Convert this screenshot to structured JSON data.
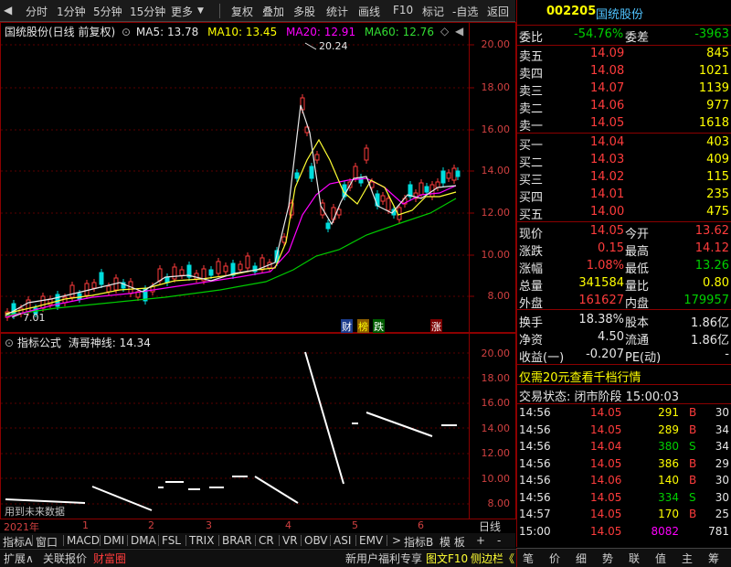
{
  "toolbar": {
    "items": [
      "分时",
      "1分钟",
      "5分钟",
      "15分钟",
      "更多",
      "复权",
      "叠加",
      "多股",
      "统计",
      "画线",
      "F10",
      "标记",
      "-自选",
      "返回"
    ]
  },
  "main_chart": {
    "title": "国统股份(日线 前复权)",
    "ma5": "MA5: 13.78",
    "ma10": "MA10: 13.45",
    "ma20": "MA20: 12.91",
    "ma60": "MA60: 12.76",
    "high_label": "20.24",
    "low_label": "7.01",
    "y_labels": [
      "20.00",
      "18.00",
      "16.00",
      "14.00",
      "12.00",
      "10.00",
      "8.00"
    ],
    "markers": [
      "财",
      "榜",
      "跌",
      "涨"
    ],
    "collapse_icon": "◇",
    "toggle_icon": "◀"
  },
  "indicator": {
    "title": "指标公式",
    "name": "涛哥神线: 14.34",
    "note": "用到未来数据",
    "y_labels": [
      "20.00",
      "18.00",
      "16.00",
      "14.00",
      "12.00",
      "10.00",
      "8.00"
    ]
  },
  "time_axis": {
    "year": "2021年",
    "months": [
      "1",
      "2",
      "3",
      "4",
      "5",
      "6"
    ],
    "period": "日线"
  },
  "indicator_tabs": {
    "left": [
      "指标A",
      "窗口",
      "MACD",
      "DMI",
      "DMA",
      "FSL",
      "TRIX",
      "BRAR",
      "CR",
      "VR",
      "OBV",
      "ASI",
      "EMV"
    ],
    "more": ">",
    "right": [
      "指标B",
      "模 板",
      "+",
      "-"
    ]
  },
  "bottom_tabs": {
    "left": [
      "扩展∧",
      "关联报价",
      "财富圈"
    ],
    "right": [
      "新用户福利专享",
      "图文F10",
      "侧边栏《"
    ],
    "panel_tabs": [
      "笔",
      "价",
      "细",
      "势",
      "联",
      "值",
      "主",
      "筹"
    ]
  },
  "quote": {
    "code": "002205",
    "name": "国统股份",
    "weibi_label": "委比",
    "weibi": "-54.76%",
    "weicha_label": "委差",
    "weicha": "-3963",
    "sells": [
      {
        "label": "卖五",
        "price": "14.09",
        "vol": "845"
      },
      {
        "label": "卖四",
        "price": "14.08",
        "vol": "1021"
      },
      {
        "label": "卖三",
        "price": "14.07",
        "vol": "1139"
      },
      {
        "label": "卖二",
        "price": "14.06",
        "vol": "977"
      },
      {
        "label": "卖一",
        "price": "14.05",
        "vol": "1618"
      }
    ],
    "buys": [
      {
        "label": "买一",
        "price": "14.04",
        "vol": "403"
      },
      {
        "label": "买二",
        "price": "14.03",
        "vol": "409"
      },
      {
        "label": "买三",
        "price": "14.02",
        "vol": "115"
      },
      {
        "label": "买四",
        "price": "14.01",
        "vol": "235"
      },
      {
        "label": "买五",
        "price": "14.00",
        "vol": "475"
      }
    ],
    "stats": [
      {
        "l1": "现价",
        "v1": "14.05",
        "l2": "今开",
        "v2": "13.62"
      },
      {
        "l1": "涨跌",
        "v1": "0.15",
        "l2": "最高",
        "v2": "14.12"
      },
      {
        "l1": "涨幅",
        "v1": "1.08%",
        "l2": "最低",
        "v2": "13.26"
      },
      {
        "l1": "总量",
        "v1": "341584",
        "l2": "量比",
        "v2": "0.80"
      },
      {
        "l1": "外盘",
        "v1": "161627",
        "l2": "内盘",
        "v2": "179957"
      }
    ],
    "stats2": [
      {
        "l1": "换手",
        "v1": "18.38%",
        "l2": "股本",
        "v2": "1.86亿"
      },
      {
        "l1": "净资",
        "v1": "4.50",
        "l2": "流通",
        "v2": "1.86亿"
      },
      {
        "l1": "收益(一)",
        "v1": "-0.207",
        "l2": "PE(动)",
        "v2": "-"
      }
    ],
    "promo": "仅需20元查看千档行情",
    "status": "交易状态: 闭市阶段 15:00:03",
    "ticks": [
      {
        "t": "14:56",
        "p": "14.05",
        "v": "291",
        "s": "B",
        "n": "30"
      },
      {
        "t": "14:56",
        "p": "14.05",
        "v": "289",
        "s": "B",
        "n": "34"
      },
      {
        "t": "14:56",
        "p": "14.04",
        "v": "380",
        "s": "S",
        "n": "34"
      },
      {
        "t": "14:56",
        "p": "14.05",
        "v": "386",
        "s": "B",
        "n": "29"
      },
      {
        "t": "14:56",
        "p": "14.06",
        "v": "140",
        "s": "B",
        "n": "30"
      },
      {
        "t": "14:56",
        "p": "14.05",
        "v": "334",
        "s": "S",
        "n": "30"
      },
      {
        "t": "14:57",
        "p": "14.05",
        "v": "170",
        "s": "B",
        "n": "25"
      },
      {
        "t": "15:00",
        "p": "14.05",
        "v": "8082",
        "s": "",
        "n": "781"
      }
    ]
  }
}
